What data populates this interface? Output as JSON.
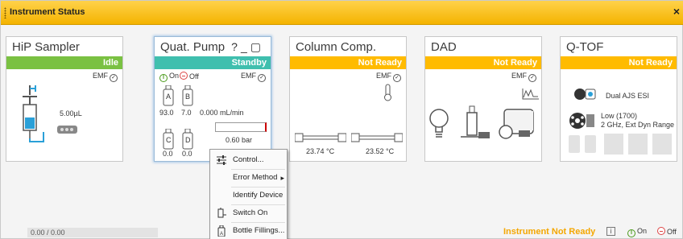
{
  "window": {
    "title": "Instrument Status"
  },
  "modules": {
    "sampler": {
      "name": "HiP Sampler",
      "status": "Idle",
      "emf": "EMF",
      "volume": "5.00µL"
    },
    "pump": {
      "name": "Quat. Pump",
      "status": "Standby",
      "emf": "EMF",
      "on_label": "On",
      "off_label": "Off",
      "bottle_a": "A",
      "bottle_b": "B",
      "bottle_c": "C",
      "bottle_d": "D",
      "level_a": "93.0",
      "level_b": "7.0",
      "level_c": "0.0",
      "level_d": "0.0",
      "flow": "0.000 mL/min",
      "pressure": "0.60 bar",
      "pressure_fraction": 0.0
    },
    "column": {
      "name": "Column Comp.",
      "status": "Not Ready",
      "emf": "EMF",
      "temp_left": "23.74 °C",
      "temp_right": "23.52 °C"
    },
    "dad": {
      "name": "DAD",
      "status": "Not Ready",
      "emf": "EMF"
    },
    "qtof": {
      "name": "Q-TOF",
      "status": "Not Ready",
      "source": "Dual AJS ESI",
      "mode_line1": "Low (1700)",
      "mode_line2": "2 GHz, Ext Dyn Range"
    }
  },
  "context_menu": {
    "items": [
      {
        "label": "Control...",
        "icon": "sliders-icon"
      },
      {
        "label": "Error Method",
        "has_submenu": true
      },
      {
        "label": "Identify Device"
      },
      {
        "label": "Switch On",
        "icon": "pump-icon"
      },
      {
        "label": "Bottle Fillings...",
        "icon": "bottle-icon"
      }
    ]
  },
  "footer": {
    "progress_text": "0.00 / 0.00",
    "instrument_status": "Instrument Not Ready",
    "info": "i",
    "on_label": "On",
    "off_label": "Off"
  },
  "colors": {
    "titlebar": "#f4b300",
    "idle": "#7ac142",
    "standby": "#3fbfae",
    "not_ready": "#ffbb00",
    "footer_status": "#f4a700"
  }
}
